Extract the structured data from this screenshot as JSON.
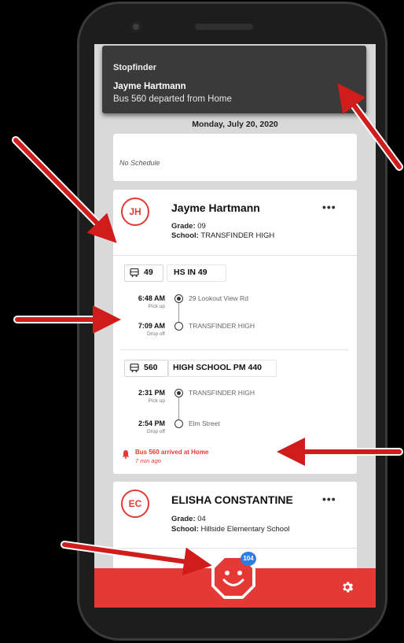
{
  "notification": {
    "app_name": "Stopfinder",
    "title": "Jayme Hartmann",
    "body": "Bus 560 departed from Home"
  },
  "date_header": "Monday, July 20, 2020",
  "no_schedule_text": "No Schedule",
  "student1": {
    "initials": "JH",
    "name": "Jayme Hartmann",
    "grade_label": "Grade:",
    "grade": "09",
    "school_label": "School:",
    "school": "TRANSFINDER HIGH",
    "more": "•••",
    "trips": [
      {
        "bus_number": "49",
        "route_name": "HS IN 49",
        "stops": [
          {
            "time": "6:48 AM",
            "sub": "Pick up",
            "name": "29 Lookout View Rd"
          },
          {
            "time": "7:09 AM",
            "sub": "Drop off",
            "name": "TRANSFINDER HIGH"
          }
        ]
      },
      {
        "bus_number": "560",
        "route_name": "HIGH SCHOOL PM 440",
        "stops": [
          {
            "time": "2:31 PM",
            "sub": "Pick up",
            "name": "TRANSFINDER HIGH"
          },
          {
            "time": "2:54 PM",
            "sub": "Drop off",
            "name": "Elm Street"
          }
        ]
      }
    ],
    "alert": "Bus 560 arrived at Home",
    "alert_time": "7 min ago"
  },
  "student2": {
    "initials": "EC",
    "name": "ELISHA CONSTANTINE",
    "grade_label": "Grade:",
    "grade": "04",
    "school_label": "School:",
    "school": "Hillside Elementary School",
    "more": "•••"
  },
  "bottom_bar": {
    "badge_count": "104",
    "fab_icon": "smiling-stop-sign-icon",
    "settings_icon": "gear-icon"
  },
  "colors": {
    "accent": "#e53935",
    "notification_bg": "#3a3a3a",
    "badge": "#2f7de1",
    "annotation_arrow": "#d11c1c"
  }
}
